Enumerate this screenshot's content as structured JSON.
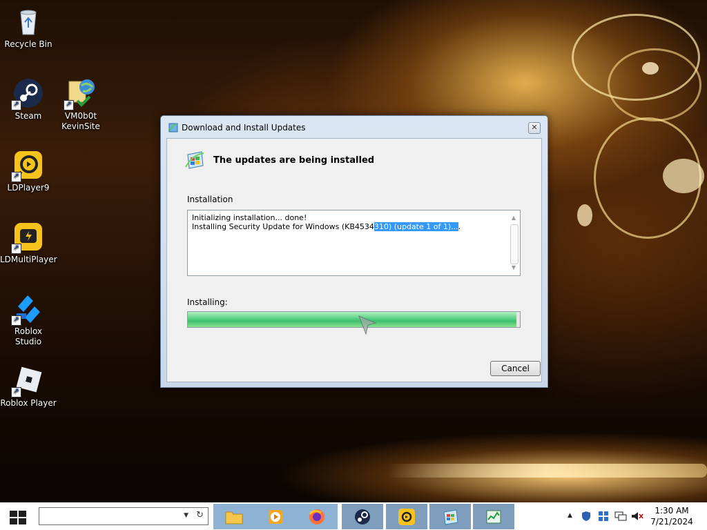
{
  "desktop": {
    "icons": [
      {
        "label": "Recycle Bin",
        "icon": "recycle-bin-icon"
      },
      {
        "label": "Steam",
        "icon": "steam-icon"
      },
      {
        "label": "VM0b0t KevinSite",
        "icon": "globe-folder-icon"
      },
      {
        "label": "LDPlayer9",
        "icon": "ldplayer-icon"
      },
      {
        "label": "LDMultiPlayer",
        "icon": "ldmultiplayer-icon"
      },
      {
        "label": "Roblox Studio",
        "icon": "roblox-studio-icon"
      },
      {
        "label": "Roblox Player",
        "icon": "roblox-player-icon"
      }
    ]
  },
  "dialog": {
    "title": "Download and Install Updates",
    "headline": "The updates are being installed",
    "installation_label": "Installation",
    "log": {
      "line1": "Initializing installation... done!",
      "line2_plain": "Installing Security Update for Windows (KB4534",
      "line2_selected": "310) (update 1 of 1)...",
      "line2_tail": "."
    },
    "progress_label": "Installing:",
    "progress_value": 0.99,
    "cancel_label": "Cancel",
    "close_glyph": "✕"
  },
  "taskbar": {
    "search_value": "",
    "pinned": [
      "file-explorer-icon",
      "media-player-icon"
    ],
    "open": [
      "firefox-icon",
      "steam-icon",
      "ldplayer-icon",
      "windows-update-icon",
      "task-manager-icon"
    ],
    "clock_time": "1:30 AM",
    "clock_date": "7/21/2024"
  },
  "colors": {
    "accent": "#3399ff",
    "progress": "#3cc06e",
    "taskbar_pinned": "#8db2d4"
  }
}
